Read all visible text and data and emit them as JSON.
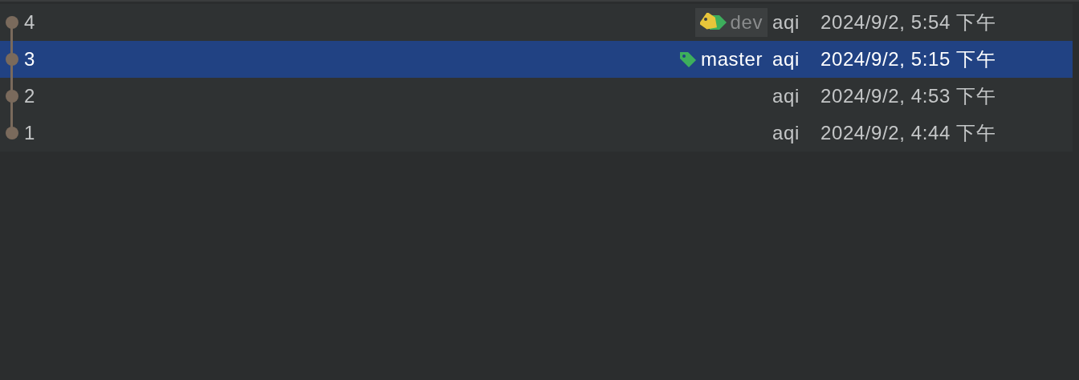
{
  "commits": [
    {
      "subject": "4",
      "refs": [
        {
          "label": "dev",
          "head": true
        }
      ],
      "author": "aqi",
      "date": "2024/9/2, 5:54 下午",
      "selected": false
    },
    {
      "subject": "3",
      "refs": [
        {
          "label": "master",
          "head": false
        }
      ],
      "author": "aqi",
      "date": "2024/9/2, 5:15 下午",
      "selected": true
    },
    {
      "subject": "2",
      "author": "aqi",
      "date": "2024/9/2, 4:53 下午",
      "selected": false
    },
    {
      "subject": "1",
      "author": "aqi",
      "date": "2024/9/2, 4:44 下午",
      "selected": false
    }
  ]
}
